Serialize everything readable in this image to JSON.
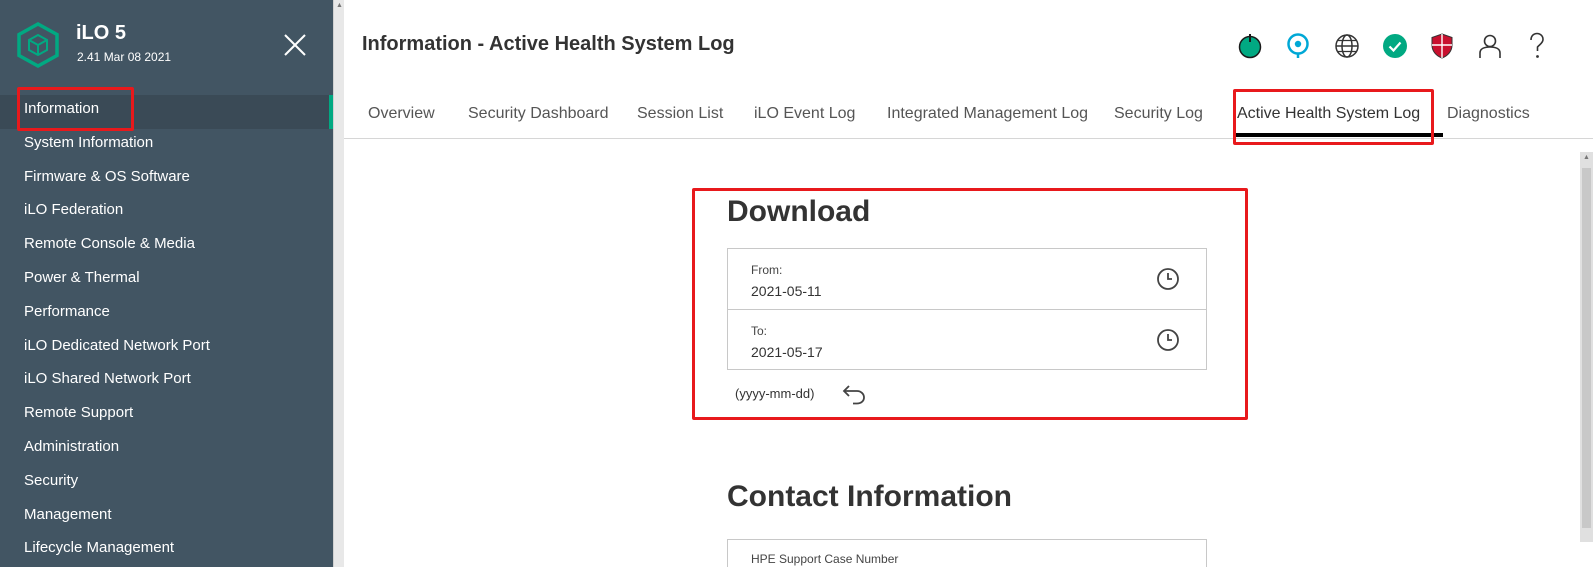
{
  "app": {
    "title": "iLO 5",
    "version": "2.41 Mar 08 2021"
  },
  "sidebar": {
    "items": [
      {
        "label": "Information",
        "active": true
      },
      {
        "label": "System Information"
      },
      {
        "label": "Firmware & OS Software"
      },
      {
        "label": "iLO Federation"
      },
      {
        "label": "Remote Console & Media"
      },
      {
        "label": "Power & Thermal"
      },
      {
        "label": "Performance"
      },
      {
        "label": "iLO Dedicated Network Port"
      },
      {
        "label": "iLO Shared Network Port"
      },
      {
        "label": "Remote Support"
      },
      {
        "label": "Administration"
      },
      {
        "label": "Security"
      },
      {
        "label": "Management"
      },
      {
        "label": "Lifecycle Management"
      }
    ]
  },
  "header": {
    "title": "Information - Active Health System Log",
    "icons": [
      "power-icon",
      "location-icon",
      "globe-icon",
      "health-check-icon",
      "security-shield-icon",
      "user-icon",
      "help-icon"
    ]
  },
  "tabs": [
    {
      "label": "Overview"
    },
    {
      "label": "Security Dashboard"
    },
    {
      "label": "Session List"
    },
    {
      "label": "iLO Event Log"
    },
    {
      "label": "Integrated Management Log"
    },
    {
      "label": "Security Log"
    },
    {
      "label": "Active Health System Log",
      "active": true
    },
    {
      "label": "Diagnostics"
    }
  ],
  "download": {
    "title": "Download",
    "from_label": "From:",
    "from_value": "2021-05-11",
    "to_label": "To:",
    "to_value": "2021-05-17",
    "format_hint": "(yyyy-mm-dd)"
  },
  "contact": {
    "title": "Contact Information",
    "case_label": "HPE Support Case Number"
  },
  "colors": {
    "sidebar_bg": "#425563",
    "accent": "#01a982",
    "highlight": "#e8191c",
    "location_blue": "#00a8d6",
    "shield_red": "#c8102e"
  }
}
